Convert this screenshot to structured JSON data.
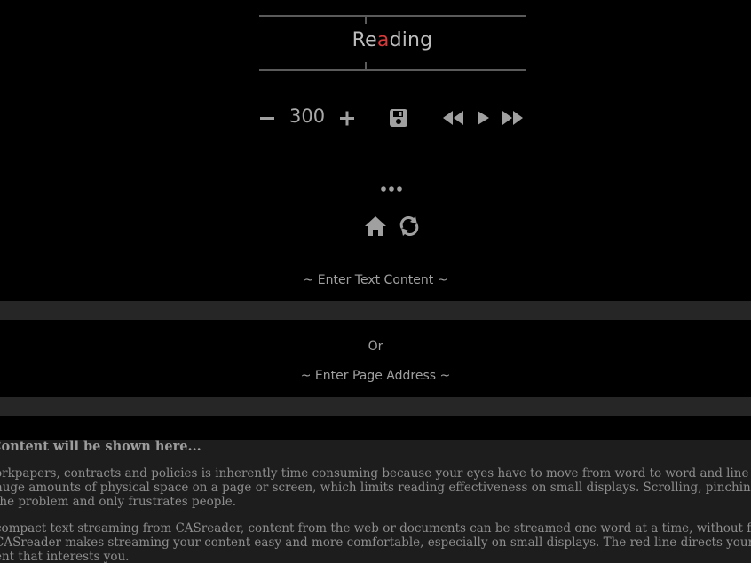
{
  "reader": {
    "word_prefix": "Re",
    "word_focus": "a",
    "word_suffix": "ding"
  },
  "controls": {
    "speed": "300",
    "icons": [
      "minus-icon",
      "plus-icon",
      "save-icon",
      "rewind-icon",
      "play-icon",
      "fast-forward-icon"
    ]
  },
  "menu": {
    "icons": [
      "more-icon",
      "home-icon",
      "reload-icon"
    ]
  },
  "text_input": {
    "label": "~ Enter Text Content ~"
  },
  "or_label": "Or",
  "url_input": {
    "label": "~ Enter Page Address ~"
  },
  "content": {
    "title": "Content will be shown here...",
    "lines": [
      "orkpapers, contracts and policies is inherently time consuming because your eyes have to move from word to word and line to line. Traditio",
      "huge amounts of physical space on a page or screen, which limits reading effectiveness on small displays. Scrolling, pinching, and resizing a",
      "the problem and only frustrates people.",
      "compact text streaming from CASreader, content from the web or documents can be streamed one word at a time, without forcing your eyes",
      "CASreader makes streaming your content easy and more comfortable, especially on small displays. The red line directs your eyes where to go",
      "ent that interests you."
    ]
  },
  "colors": {
    "background": "#000000",
    "focus_letter": "#d63a3a",
    "input_bar": "#262626",
    "content_bg": "#1d1d1d"
  }
}
